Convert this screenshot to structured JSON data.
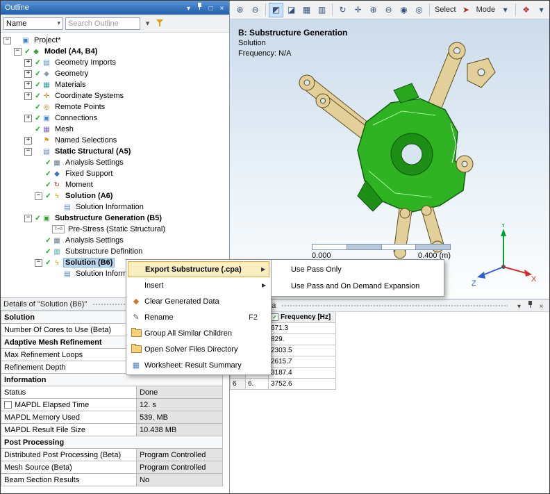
{
  "glyphs": {
    "check": "✓",
    "plus": "+",
    "minus": "−",
    "arrow_right": "▶",
    "chevron_down": "▾"
  },
  "outline": {
    "title": "Outline",
    "name_filter_label": "Name",
    "search_placeholder": "Search Outline",
    "window_icons": [
      {
        "name": "chevron-down-icon",
        "glyph": "▾"
      },
      {
        "name": "pin-icon",
        "glyph": "pin"
      },
      {
        "name": "maximize-icon",
        "glyph": "□"
      },
      {
        "name": "close-icon",
        "glyph": "×"
      }
    ],
    "tree": [
      {
        "depth": 0,
        "expander": "minus",
        "icon": "project",
        "label": "Project*"
      },
      {
        "depth": 1,
        "expander": "minus",
        "check": true,
        "icon": "model",
        "label": "Model (A4, B4)",
        "bold": true
      },
      {
        "depth": 2,
        "expander": "plus",
        "check": true,
        "icon": "geometry-imports",
        "label": "Geometry Imports"
      },
      {
        "depth": 2,
        "expander": "plus",
        "check": true,
        "icon": "geometry",
        "label": "Geometry"
      },
      {
        "depth": 2,
        "expander": "plus",
        "check": true,
        "icon": "materials",
        "label": "Materials"
      },
      {
        "depth": 2,
        "expander": "plus",
        "check": true,
        "icon": "coordinate-systems",
        "label": "Coordinate Systems"
      },
      {
        "depth": 2,
        "expander": "none",
        "check": true,
        "icon": "remote-points",
        "label": "Remote Points"
      },
      {
        "depth": 2,
        "expander": "plus",
        "check": true,
        "icon": "connections",
        "label": "Connections"
      },
      {
        "depth": 2,
        "expander": "none",
        "check": true,
        "icon": "mesh",
        "label": "Mesh"
      },
      {
        "depth": 2,
        "expander": "plus",
        "check": false,
        "icon": "named-selections",
        "label": "Named Selections"
      },
      {
        "depth": 2,
        "expander": "minus",
        "check": false,
        "icon": "static-structural",
        "label": "Static Structural (A5)",
        "bold": true
      },
      {
        "depth": 3,
        "expander": "none",
        "check": true,
        "icon": "analysis-settings",
        "label": "Analysis Settings"
      },
      {
        "depth": 3,
        "expander": "none",
        "check": true,
        "icon": "fixed-support",
        "label": "Fixed Support"
      },
      {
        "depth": 3,
        "expander": "none",
        "check": true,
        "icon": "moment",
        "label": "Moment"
      },
      {
        "depth": 3,
        "expander": "minus",
        "check": true,
        "icon": "solution",
        "label": "Solution (A6)",
        "bold": true
      },
      {
        "depth": 4,
        "expander": "none",
        "check": false,
        "icon": "solution-information",
        "label": "Solution Information"
      },
      {
        "depth": 2,
        "expander": "minus",
        "check": true,
        "icon": "substructure-generation",
        "label": "Substructure Generation (B5)",
        "bold": true
      },
      {
        "depth": 3,
        "expander": "none",
        "check": false,
        "icon": "pre-stress",
        "label": "Pre-Stress (Static Structural)"
      },
      {
        "depth": 3,
        "expander": "none",
        "check": true,
        "icon": "analysis-settings",
        "label": "Analysis Settings"
      },
      {
        "depth": 3,
        "expander": "none",
        "check": true,
        "icon": "substructure-definition",
        "label": "Substructure Definition"
      },
      {
        "depth": 3,
        "expander": "minus",
        "check": true,
        "icon": "solution",
        "label": "Solution (B6)",
        "bold": true,
        "selected": true
      },
      {
        "depth": 4,
        "expander": "none",
        "check": false,
        "icon": "solution-information",
        "label": "Solution Information"
      }
    ]
  },
  "main_toolbar": {
    "items": [
      {
        "type": "button",
        "name": "zoom-box-in-icon",
        "glyph": "⊕"
      },
      {
        "type": "button",
        "name": "zoom-box-out-icon",
        "glyph": "⊖"
      },
      {
        "type": "sep"
      },
      {
        "type": "button",
        "name": "iso-view-icon",
        "glyph": "◩",
        "active": true
      },
      {
        "type": "button",
        "name": "look-at-face-icon",
        "glyph": "◪"
      },
      {
        "type": "button",
        "name": "wireframe-view-icon",
        "glyph": "▦"
      },
      {
        "type": "button",
        "name": "viewports-icon",
        "glyph": "▥"
      },
      {
        "type": "sep"
      },
      {
        "type": "button",
        "name": "rotate-icon",
        "glyph": "↻"
      },
      {
        "type": "button",
        "name": "pan-icon",
        "glyph": "✛"
      },
      {
        "type": "button",
        "name": "zoom-in-icon",
        "glyph": "⊕"
      },
      {
        "type": "button",
        "name": "zoom-out-icon",
        "glyph": "⊖"
      },
      {
        "type": "button",
        "name": "zoom-fit-icon",
        "glyph": "◉"
      },
      {
        "type": "button",
        "name": "magnifier-window-icon",
        "glyph": "◎"
      },
      {
        "type": "sep"
      },
      {
        "type": "label",
        "name": "select-label",
        "text": "Select"
      },
      {
        "type": "button",
        "name": "select-mode-icon",
        "glyph": "➤",
        "color": "#b03030"
      },
      {
        "type": "label",
        "name": "mode-label",
        "text": "Mode"
      },
      {
        "type": "button",
        "name": "mode-dropdown-icon",
        "glyph": "▾"
      },
      {
        "type": "sep"
      },
      {
        "type": "button",
        "name": "selection-filter-icon",
        "glyph": "❖",
        "color": "#b03030"
      },
      {
        "type": "button",
        "name": "filter-dropdown-icon",
        "glyph": "▾"
      }
    ]
  },
  "viewport": {
    "annotation_title": "B: Substructure Generation",
    "annotation_line2": "Solution",
    "annotation_line3": "Frequency: N/A",
    "ruler_left_label": "0.000",
    "ruler_right_label": "0.400 (m)",
    "triad": {
      "x": "X",
      "y": "Y",
      "z": "Z"
    }
  },
  "context_menu": {
    "items": [
      {
        "label": "Export Substructure (.cpa)",
        "highlighted": true,
        "arrow": true
      },
      {
        "label": "Insert",
        "arrow": true
      },
      {
        "label": "Clear Generated Data",
        "icon": "clear-generated-data-icon"
      },
      {
        "label": "Rename",
        "icon": "rename-icon",
        "shortcut": "F2"
      },
      {
        "label": "Group All Similar Children",
        "icon": "folder-icon"
      },
      {
        "label": "Open Solver Files Directory",
        "icon": "folder-icon"
      },
      {
        "label": "Worksheet: Result Summary",
        "icon": "worksheet-icon"
      }
    ],
    "submenu": [
      {
        "label": "Use Pass Only"
      },
      {
        "label": "Use Pass and On Demand Expansion"
      }
    ]
  },
  "details": {
    "title": "Details of \"Solution (B6)\"",
    "window_icons": [
      {
        "name": "chevron-down-icon",
        "glyph": "▾"
      },
      {
        "name": "pin-icon",
        "glyph": "pin"
      }
    ],
    "rows": [
      {
        "type": "header",
        "label": "Solution"
      },
      {
        "type": "row",
        "label": "Number Of Cores to Use (Beta)",
        "value": ""
      },
      {
        "type": "header",
        "label": "Adaptive Mesh Refinement"
      },
      {
        "type": "row",
        "label": "Max Refinement Loops",
        "value": ""
      },
      {
        "type": "row",
        "label": "Refinement Depth",
        "value": ""
      },
      {
        "type": "header",
        "label": "Information"
      },
      {
        "type": "row",
        "label": "Status",
        "value": "Done"
      },
      {
        "type": "row",
        "label": "MAPDL Elapsed Time",
        "value": "12. s",
        "checkbox": true
      },
      {
        "type": "row",
        "label": "MAPDL Memory Used",
        "value": "539. MB"
      },
      {
        "type": "row",
        "label": "MAPDL Result File Size",
        "value": "10.438 MB"
      },
      {
        "type": "header",
        "label": "Post Processing"
      },
      {
        "type": "row",
        "label": "Distributed Post Processing (Beta)",
        "value": "Program Controlled"
      },
      {
        "type": "row",
        "label": "Mesh Source (Beta)",
        "value": "Program Controlled"
      },
      {
        "type": "row",
        "label": "Beam Section Results",
        "value": "No"
      }
    ]
  },
  "tabular": {
    "title": "Tabular Data",
    "window_icons": [
      {
        "name": "chevron-down-icon",
        "glyph": "▾"
      },
      {
        "name": "pin-icon",
        "glyph": "pin"
      },
      {
        "name": "close-icon",
        "glyph": "×"
      }
    ],
    "columns": [
      "",
      "",
      "Frequency [Hz]"
    ],
    "header_checkbox": true,
    "rows": [
      [
        "",
        "",
        "671.3"
      ],
      [
        "",
        "",
        "829."
      ],
      [
        "",
        "",
        "2303.5"
      ],
      [
        "",
        "",
        "2615.7"
      ],
      [
        "",
        "",
        "3187.4"
      ],
      [
        "6",
        "6.",
        "3752.6"
      ]
    ]
  }
}
